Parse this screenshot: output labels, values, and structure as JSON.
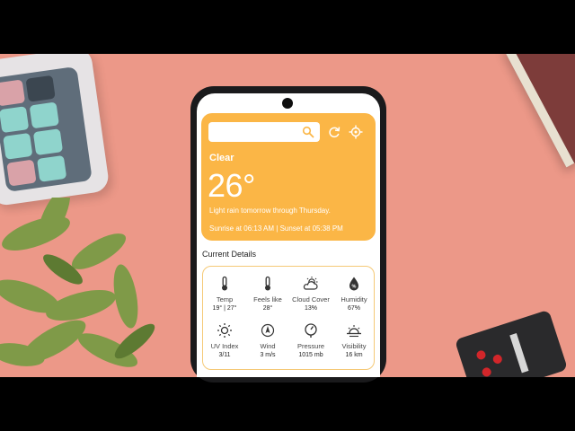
{
  "search": {
    "placeholder": ""
  },
  "weather": {
    "condition": "Clear",
    "temperature": "26°",
    "forecast": "Light rain tomorrow through Thursday.",
    "sun_times": "Sunrise at 06:13 AM | Sunset at 05:38 PM"
  },
  "section": {
    "title": "Current Details"
  },
  "details": [
    {
      "label": "Temp",
      "value": "19° | 27°",
      "icon": "thermometer-icon"
    },
    {
      "label": "Feels like",
      "value": "28°",
      "icon": "thermometer-icon"
    },
    {
      "label": "Cloud Cover",
      "value": "13%",
      "icon": "partly-cloudy-icon"
    },
    {
      "label": "Humidity",
      "value": "67%",
      "icon": "humidity-drop-icon"
    },
    {
      "label": "UV Index",
      "value": "3/11",
      "icon": "sun-icon"
    },
    {
      "label": "Wind",
      "value": "3 m/s",
      "icon": "wind-icon"
    },
    {
      "label": "Pressure",
      "value": "1015 mb",
      "icon": "gauge-icon"
    },
    {
      "label": "Visibility",
      "value": "16 km",
      "icon": "sunrise-horizon-icon"
    }
  ],
  "colors": {
    "card": "#fbb646",
    "background": "#ec9888",
    "detail_border": "#f5c976"
  }
}
